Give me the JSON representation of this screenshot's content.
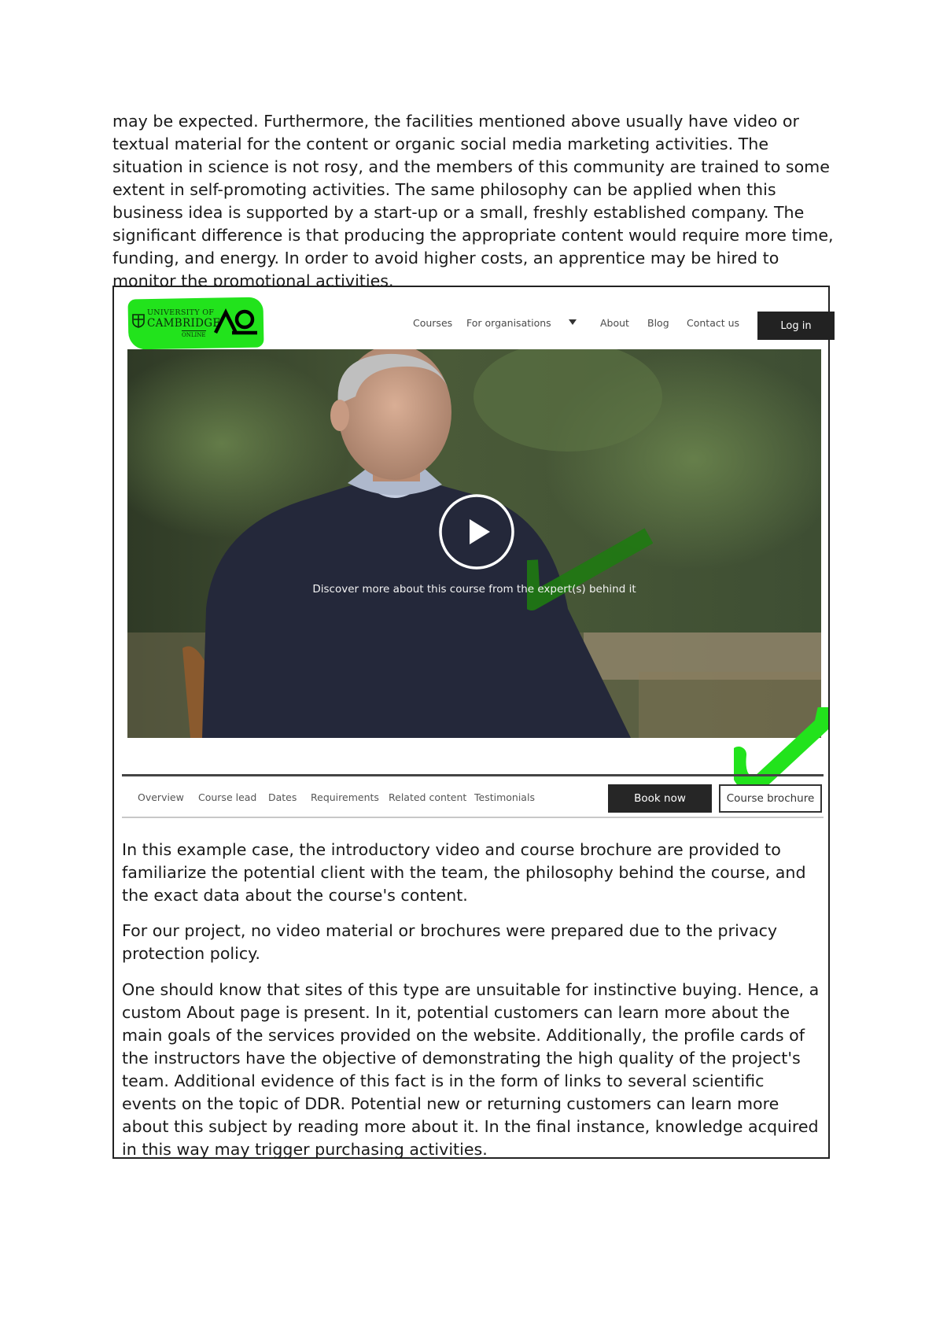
{
  "intro_paragraph": "may be expected. Furthermore, the facilities mentioned above usually have video or textual material for the content or organic social media marketing activities.  The situation in science is not rosy, and the members of this community are trained to some extent in self-promoting activities. The same philosophy can be applied when this business idea is supported by a start-up or a small, freshly established company. The significant difference is that producing the appropriate content would require more time, funding, and energy. In order to avoid higher costs, an apprentice may be hired to monitor the promotional activities.",
  "screenshot": {
    "logo": {
      "line1": "UNIVERSITY OF",
      "line2": "CAMBRIDGE",
      "line3": "ONLINE",
      "highlight_color": "#22e31c"
    },
    "nav": {
      "courses": "Courses",
      "for_organisations": "For organisations",
      "about": "About",
      "blog": "Blog",
      "contact": "Contact us",
      "login": "Log in"
    },
    "video": {
      "caption": "Discover more about this course from the expert(s) behind it"
    },
    "tabs": [
      "Overview",
      "Course lead",
      "Dates",
      "Requirements",
      "Related content",
      "Testimonials"
    ],
    "book_now": "Book now",
    "course_brochure": "Course brochure",
    "annotation_colors": {
      "dark_check": "#1f7a12",
      "bright_check": "#22e31c"
    }
  },
  "paragraphs": [
    "In this example case, the introductory video and course brochure are provided to familiarize the potential client with the team, the philosophy behind the course, and the exact data about the course's content.",
    "For our project, no video material or brochures were prepared due to the privacy protection policy.",
    "One should know that sites of this type are unsuitable for instinctive buying. Hence, a custom About page is present. In it, potential customers can learn more about the main goals of the services provided on the website. Additionally, the profile cards of the instructors have the objective of demonstrating the high quality of the project's team. Additional evidence of this fact is in the form of links to several scientific events on the topic of DDR. Potential new or returning customers can learn more about this subject by reading more about it. In the final instance, knowledge acquired in this way may trigger purchasing activities."
  ]
}
